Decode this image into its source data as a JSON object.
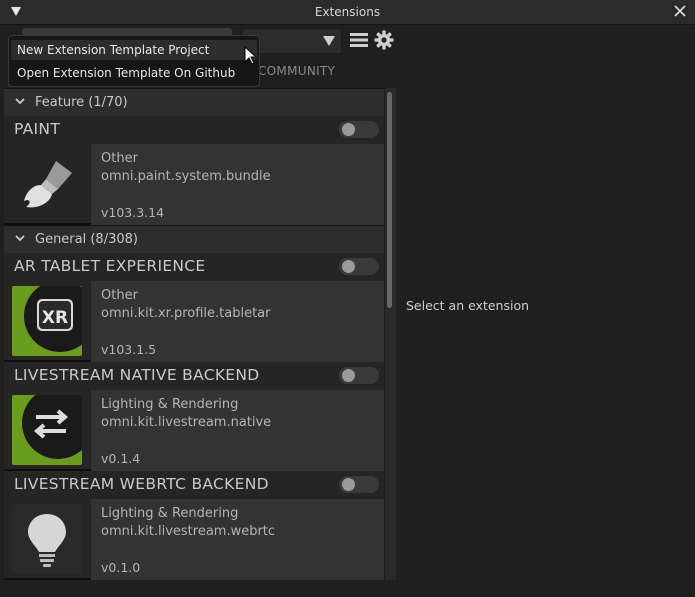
{
  "window": {
    "title": "Extensions"
  },
  "toolbar": {
    "tab_community": "COMMUNITY"
  },
  "popup_menu": {
    "items": [
      {
        "label": "New Extension Template Project"
      },
      {
        "label": "Open Extension Template On Github"
      }
    ]
  },
  "groups": [
    {
      "label": "Feature (1/70)",
      "extensions": [
        {
          "name": "PAINT",
          "category": "Other",
          "package": "omni.paint.system.bundle",
          "version": "v103.3.14",
          "enabled": false,
          "icon": "paintbrush-icon"
        }
      ]
    },
    {
      "label": "General (8/308)",
      "extensions": [
        {
          "name": "AR TABLET EXPERIENCE",
          "category": "Other",
          "package": "omni.kit.xr.profile.tabletar",
          "version": "v103.1.5",
          "enabled": false,
          "icon": "xr-badge-icon",
          "icon_text": "XR"
        },
        {
          "name": "LIVESTREAM NATIVE BACKEND",
          "category": "Lighting & Rendering",
          "package": "omni.kit.livestream.native",
          "version": "v0.1.4",
          "enabled": false,
          "icon": "swap-arrows-icon"
        },
        {
          "name": "LIVESTREAM WEBRTC BACKEND",
          "category": "Lighting & Rendering",
          "package": "omni.kit.livestream.webrtc",
          "version": "v0.1.0",
          "enabled": false,
          "icon": "lightbulb-icon"
        }
      ]
    }
  ],
  "detail": {
    "placeholder": "Select an extension"
  },
  "colors": {
    "accent_green": "#6a9d1e",
    "panel": "#252525",
    "info_panel": "#333333"
  }
}
